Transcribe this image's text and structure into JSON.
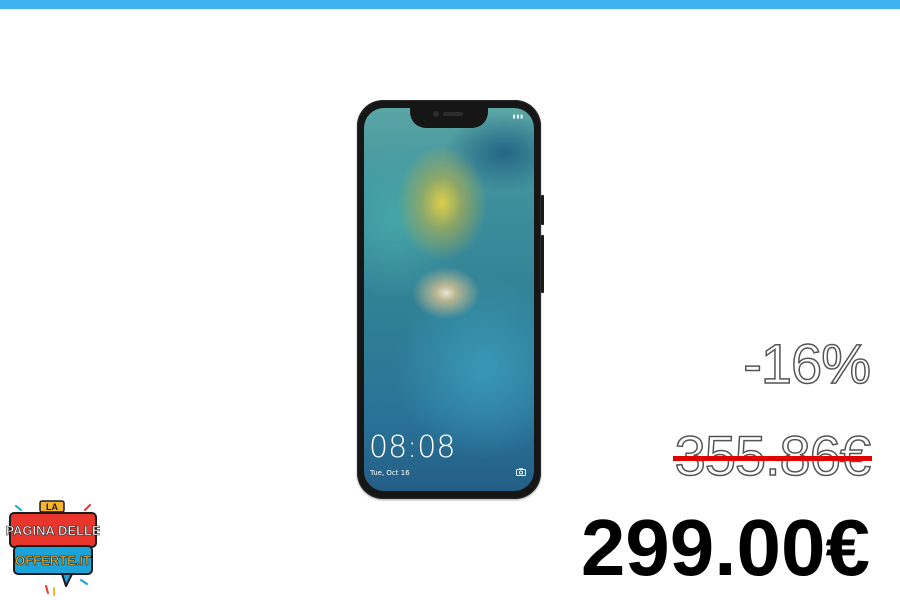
{
  "header": {
    "accent_color": "#3eb1f0"
  },
  "product": {
    "image_name": "smartphone-image",
    "lock_screen_time": "08:08",
    "lock_screen_date": "Tue, Oct 16"
  },
  "pricing": {
    "discount": "-16%",
    "old_price": "355.86€",
    "new_price": "299.00€",
    "strike_color": "#e00000"
  },
  "logo": {
    "line1": "LA",
    "line2": "PAGINA DELLE",
    "line3": "OFFERTE.IT",
    "colors": {
      "primary": "#e9362d",
      "secondary": "#1ca4d8",
      "accent": "#f6b52c"
    }
  }
}
